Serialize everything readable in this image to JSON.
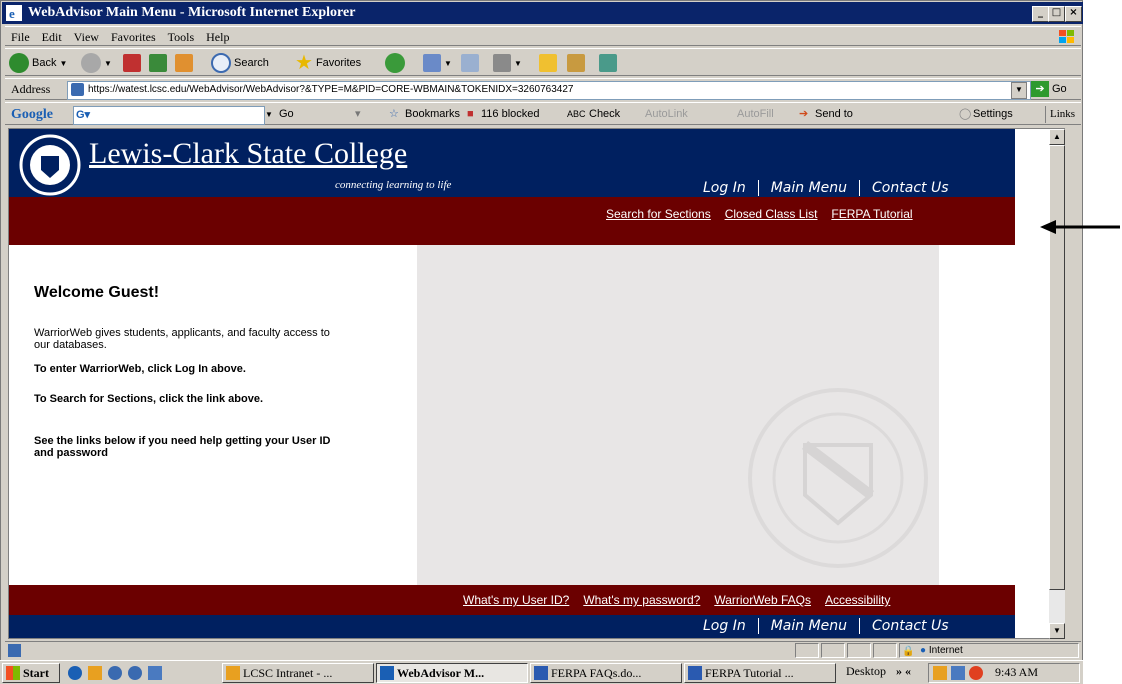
{
  "window": {
    "title": "WebAdvisor Main Menu - Microsoft Internet Explorer"
  },
  "menu": [
    "File",
    "Edit",
    "View",
    "Favorites",
    "Tools",
    "Help"
  ],
  "toolbar": {
    "back": "Back",
    "search": "Search",
    "favorites": "Favorites"
  },
  "address": {
    "label": "Address",
    "url": "https://watest.lcsc.edu/WebAdvisor/WebAdvisor?&TYPE=M&PID=CORE-WBMAIN&TOKENIDX=3260763427",
    "go": "Go"
  },
  "google": {
    "brand": "Google",
    "go": "Go",
    "bookmarks": "Bookmarks",
    "blocked": "116 blocked",
    "check": "Check",
    "autolink": "AutoLink",
    "autofill": "AutoFill",
    "sendto": "Send to",
    "settings": "Settings",
    "links": "Links"
  },
  "page": {
    "school": "Lewis-Clark State College",
    "tagline": "connecting learning to life",
    "nav": {
      "login": "Log In",
      "mainmenu": "Main Menu",
      "contact": "Contact Us"
    },
    "sublinks": [
      "Search for Sections",
      "Closed Class List",
      "FERPA Tutorial"
    ],
    "welcome": "Welcome Guest!",
    "p1": "WarriorWeb gives students, applicants, and faculty access to our databases.",
    "p2": "To enter WarriorWeb, click Log In above.",
    "p3": "To Search for Sections, click the link above.",
    "p4": "See the links below if you need help getting your User ID and password",
    "footlinks": [
      "What's my User ID?",
      "What's my password?",
      "WarriorWeb FAQs",
      "Accessibility"
    ]
  },
  "status": {
    "zone": "Internet"
  },
  "taskbar": {
    "start": "Start",
    "items": [
      "LCSC Intranet - ...",
      "WebAdvisor M...",
      "FERPA FAQs.do...",
      "FERPA Tutorial ..."
    ],
    "desktop": "Desktop",
    "time": "9:43 AM"
  }
}
